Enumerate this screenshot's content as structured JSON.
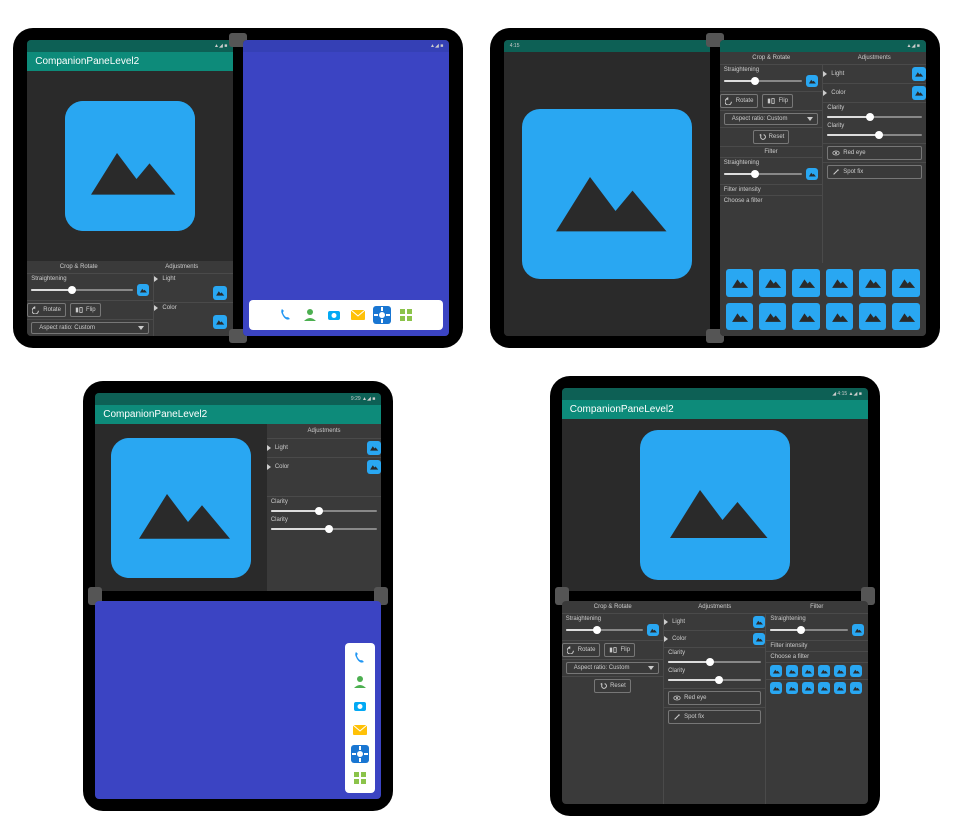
{
  "app_title": "CompanionPaneLevel2",
  "statusbar": {
    "time_a": "4:15",
    "time_b": "9:29",
    "sig": "▲◢ ■"
  },
  "panel": {
    "header_crop": "Crop & Rotate",
    "header_adjust": "Adjustments",
    "header_filter": "Filter",
    "straight": "Straightening",
    "rotate": "Rotate",
    "flip": "Flip",
    "aspect": "Aspect ratio: Custom",
    "reset": "Reset",
    "light": "Light",
    "color": "Color",
    "clarity": "Clarity",
    "redeye": "Red eye",
    "spotfix": "Spot fix",
    "filter_intensity": "Filter intensity",
    "choose_filter": "Choose a filter"
  },
  "sliders": {
    "straight_pct": 40,
    "filter_pct": 30,
    "clarity1_pct": 45,
    "clarity2_pct": 55
  },
  "dock_apps": [
    "phone",
    "contacts",
    "camera",
    "messages",
    "settings",
    "apps"
  ],
  "colors": {
    "phone": "#2196f3",
    "contacts": "#4caf50",
    "camera": "#03a9f4",
    "messages": "#ffc107",
    "settings": "#1976d2",
    "apps": "#8bc34a"
  }
}
